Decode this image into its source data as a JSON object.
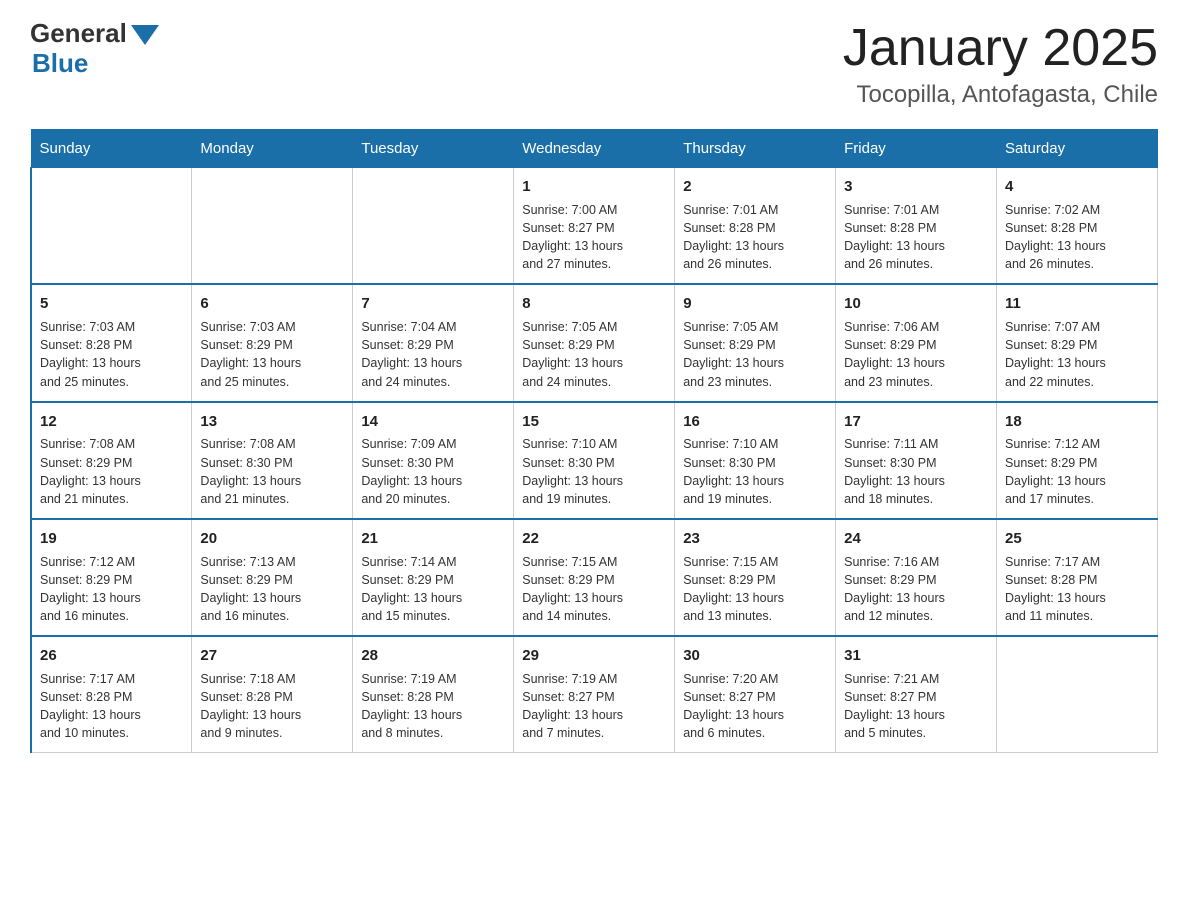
{
  "header": {
    "logo_general": "General",
    "logo_blue": "Blue",
    "title": "January 2025",
    "subtitle": "Tocopilla, Antofagasta, Chile"
  },
  "days_of_week": [
    "Sunday",
    "Monday",
    "Tuesday",
    "Wednesday",
    "Thursday",
    "Friday",
    "Saturday"
  ],
  "weeks": [
    [
      {
        "day": "",
        "info": ""
      },
      {
        "day": "",
        "info": ""
      },
      {
        "day": "",
        "info": ""
      },
      {
        "day": "1",
        "info": "Sunrise: 7:00 AM\nSunset: 8:27 PM\nDaylight: 13 hours\nand 27 minutes."
      },
      {
        "day": "2",
        "info": "Sunrise: 7:01 AM\nSunset: 8:28 PM\nDaylight: 13 hours\nand 26 minutes."
      },
      {
        "day": "3",
        "info": "Sunrise: 7:01 AM\nSunset: 8:28 PM\nDaylight: 13 hours\nand 26 minutes."
      },
      {
        "day": "4",
        "info": "Sunrise: 7:02 AM\nSunset: 8:28 PM\nDaylight: 13 hours\nand 26 minutes."
      }
    ],
    [
      {
        "day": "5",
        "info": "Sunrise: 7:03 AM\nSunset: 8:28 PM\nDaylight: 13 hours\nand 25 minutes."
      },
      {
        "day": "6",
        "info": "Sunrise: 7:03 AM\nSunset: 8:29 PM\nDaylight: 13 hours\nand 25 minutes."
      },
      {
        "day": "7",
        "info": "Sunrise: 7:04 AM\nSunset: 8:29 PM\nDaylight: 13 hours\nand 24 minutes."
      },
      {
        "day": "8",
        "info": "Sunrise: 7:05 AM\nSunset: 8:29 PM\nDaylight: 13 hours\nand 24 minutes."
      },
      {
        "day": "9",
        "info": "Sunrise: 7:05 AM\nSunset: 8:29 PM\nDaylight: 13 hours\nand 23 minutes."
      },
      {
        "day": "10",
        "info": "Sunrise: 7:06 AM\nSunset: 8:29 PM\nDaylight: 13 hours\nand 23 minutes."
      },
      {
        "day": "11",
        "info": "Sunrise: 7:07 AM\nSunset: 8:29 PM\nDaylight: 13 hours\nand 22 minutes."
      }
    ],
    [
      {
        "day": "12",
        "info": "Sunrise: 7:08 AM\nSunset: 8:29 PM\nDaylight: 13 hours\nand 21 minutes."
      },
      {
        "day": "13",
        "info": "Sunrise: 7:08 AM\nSunset: 8:30 PM\nDaylight: 13 hours\nand 21 minutes."
      },
      {
        "day": "14",
        "info": "Sunrise: 7:09 AM\nSunset: 8:30 PM\nDaylight: 13 hours\nand 20 minutes."
      },
      {
        "day": "15",
        "info": "Sunrise: 7:10 AM\nSunset: 8:30 PM\nDaylight: 13 hours\nand 19 minutes."
      },
      {
        "day": "16",
        "info": "Sunrise: 7:10 AM\nSunset: 8:30 PM\nDaylight: 13 hours\nand 19 minutes."
      },
      {
        "day": "17",
        "info": "Sunrise: 7:11 AM\nSunset: 8:30 PM\nDaylight: 13 hours\nand 18 minutes."
      },
      {
        "day": "18",
        "info": "Sunrise: 7:12 AM\nSunset: 8:29 PM\nDaylight: 13 hours\nand 17 minutes."
      }
    ],
    [
      {
        "day": "19",
        "info": "Sunrise: 7:12 AM\nSunset: 8:29 PM\nDaylight: 13 hours\nand 16 minutes."
      },
      {
        "day": "20",
        "info": "Sunrise: 7:13 AM\nSunset: 8:29 PM\nDaylight: 13 hours\nand 16 minutes."
      },
      {
        "day": "21",
        "info": "Sunrise: 7:14 AM\nSunset: 8:29 PM\nDaylight: 13 hours\nand 15 minutes."
      },
      {
        "day": "22",
        "info": "Sunrise: 7:15 AM\nSunset: 8:29 PM\nDaylight: 13 hours\nand 14 minutes."
      },
      {
        "day": "23",
        "info": "Sunrise: 7:15 AM\nSunset: 8:29 PM\nDaylight: 13 hours\nand 13 minutes."
      },
      {
        "day": "24",
        "info": "Sunrise: 7:16 AM\nSunset: 8:29 PM\nDaylight: 13 hours\nand 12 minutes."
      },
      {
        "day": "25",
        "info": "Sunrise: 7:17 AM\nSunset: 8:28 PM\nDaylight: 13 hours\nand 11 minutes."
      }
    ],
    [
      {
        "day": "26",
        "info": "Sunrise: 7:17 AM\nSunset: 8:28 PM\nDaylight: 13 hours\nand 10 minutes."
      },
      {
        "day": "27",
        "info": "Sunrise: 7:18 AM\nSunset: 8:28 PM\nDaylight: 13 hours\nand 9 minutes."
      },
      {
        "day": "28",
        "info": "Sunrise: 7:19 AM\nSunset: 8:28 PM\nDaylight: 13 hours\nand 8 minutes."
      },
      {
        "day": "29",
        "info": "Sunrise: 7:19 AM\nSunset: 8:27 PM\nDaylight: 13 hours\nand 7 minutes."
      },
      {
        "day": "30",
        "info": "Sunrise: 7:20 AM\nSunset: 8:27 PM\nDaylight: 13 hours\nand 6 minutes."
      },
      {
        "day": "31",
        "info": "Sunrise: 7:21 AM\nSunset: 8:27 PM\nDaylight: 13 hours\nand 5 minutes."
      },
      {
        "day": "",
        "info": ""
      }
    ]
  ]
}
